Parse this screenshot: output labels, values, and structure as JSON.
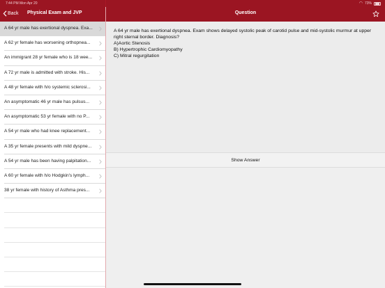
{
  "status_bar": {
    "time": "7:44 PM  Mon Apr 20",
    "battery": "73%"
  },
  "left_header": {
    "back_label": "Back",
    "title": "Physical Exam and JVP"
  },
  "right_header": {
    "title": "Question"
  },
  "questions": [
    "A 64 yr male has exertional dyspnea. Exa...",
    "A 62 yr female has worsening orthopnea...",
    "An immigrant 28 yr female who is 18 wee...",
    "A 72 yr male is admitted with stroke. His...",
    "A 48 yr female with h/o systemic sclerosi...",
    "An asymptomatic 46 yr male has pulsus...",
    "An asymptomatic 53 yr female with no P...",
    "A 54 yr male who had knee replacement...",
    "A 35 yr female presents with mild dyspne...",
    "A 54 yr male has been having palpitation...",
    "A 60 yr female with h/o Hodgkin's lymph...",
    "38 yr female with history of Asthma pres..."
  ],
  "selected_index": 0,
  "question": {
    "text": "A 64 yr male has exertional dyspnea. Exam shows delayed systolic peak of carotid pulse and mid-systolic murmur at upper right sternal border. Diagnosis?",
    "options": [
      "A)Aortic Stenosis",
      "B) Hypertrophic Cardiomyopathy",
      "C) Mitral regurgitation"
    ]
  },
  "show_answer_label": "Show Answer",
  "colors": {
    "header": "#9b1522",
    "selected_row": "#d9d9d9",
    "background": "#ececec"
  },
  "icons": [
    "back-chevron-icon",
    "star-icon",
    "chevron-right-icon",
    "wifi-icon",
    "battery-icon"
  ]
}
